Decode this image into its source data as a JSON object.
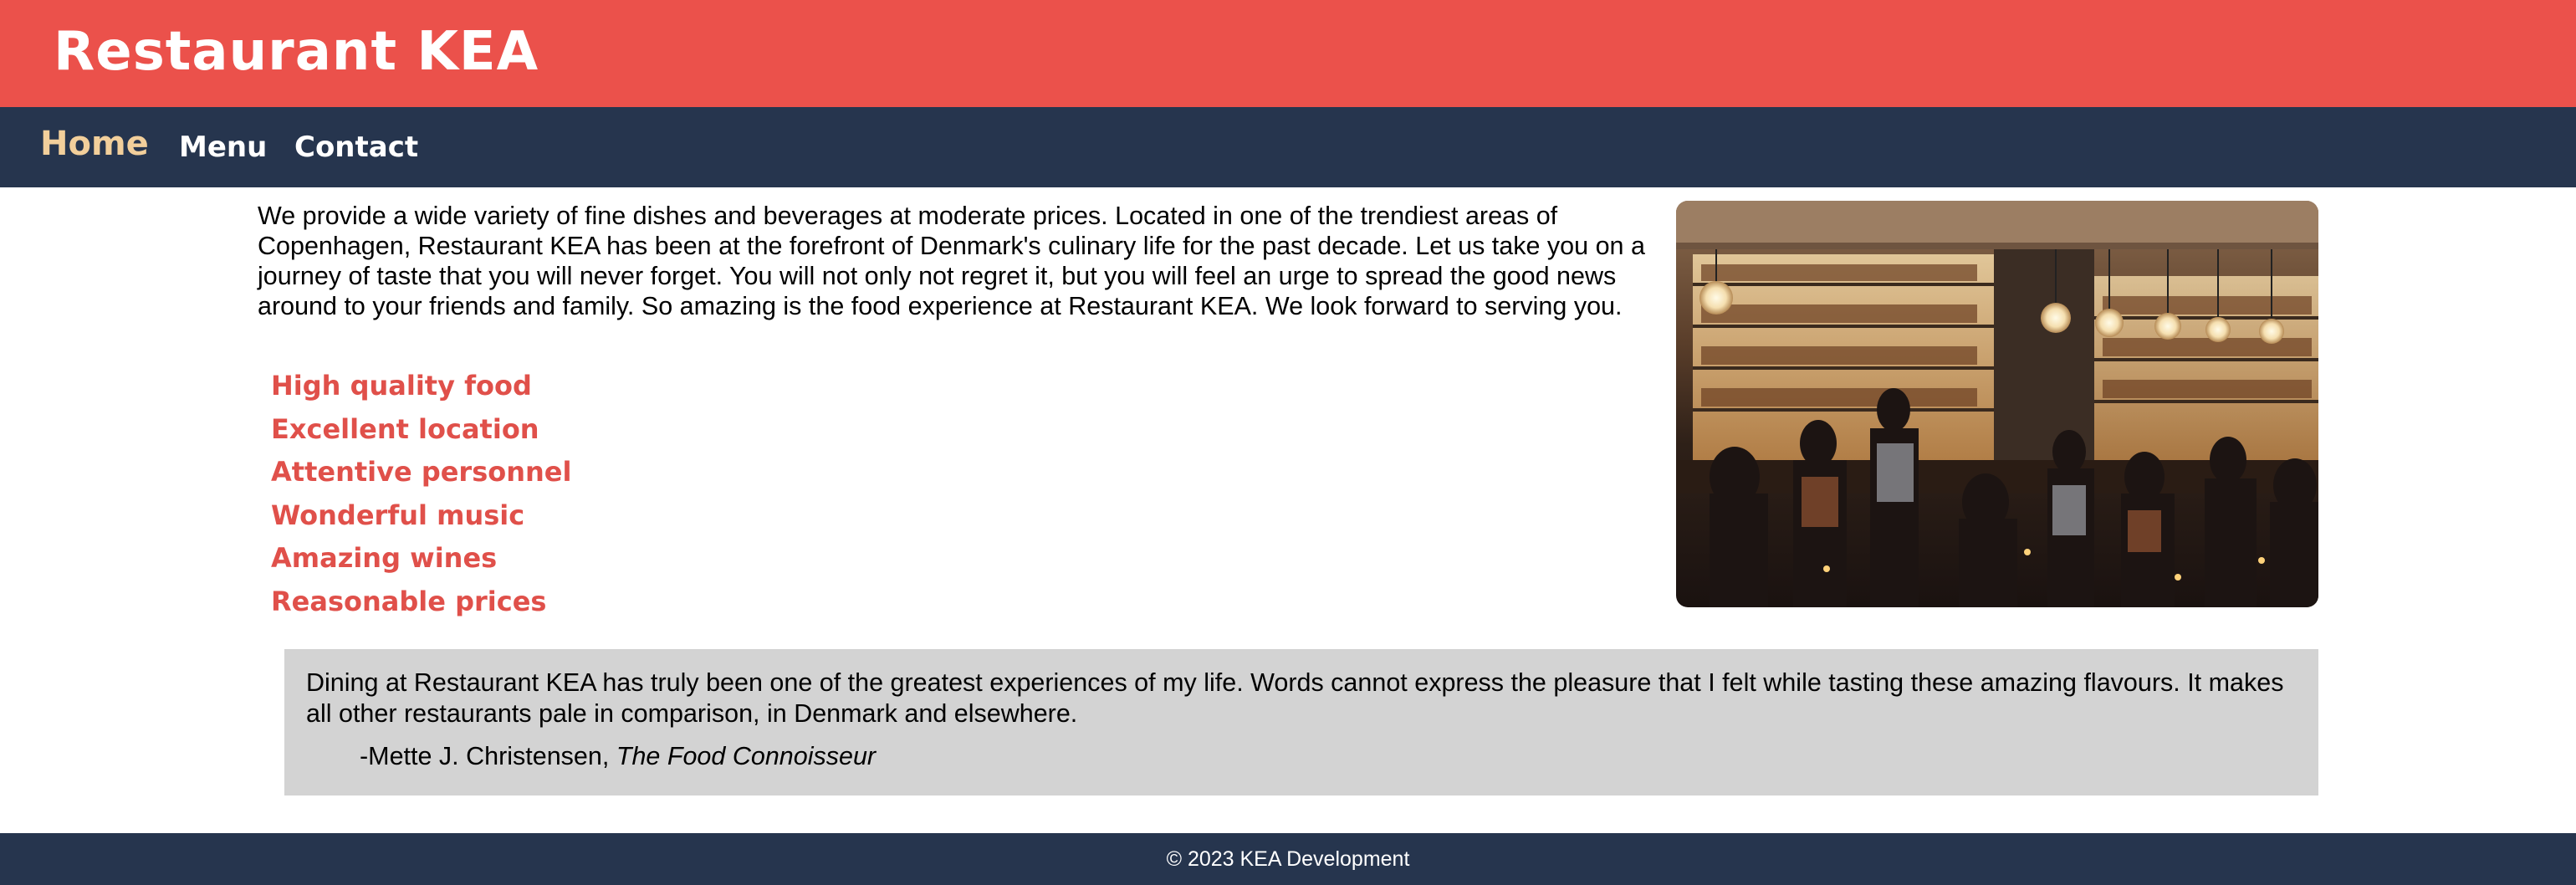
{
  "header": {
    "title": "Restaurant KEA"
  },
  "nav": {
    "items": [
      {
        "label": "Home"
      },
      {
        "label": "Menu"
      },
      {
        "label": "Contact"
      }
    ],
    "active_color": "#f2cf9b"
  },
  "intro": {
    "text": "We provide a wide variety of fine dishes and beverages at moderate prices. Located in one of the trendiest areas of Copenhagen, Restaurant KEA has been at the forefront of Denmark's culinary life for the past decade. Let us take you on a journey of taste that you will never forget. You will not only not regret it, but you will feel an urge to spread the good news around to your friends and family. So amazing is the food experience at Restaurant KEA. We look forward to serving you."
  },
  "features": [
    "High quality food",
    "Excellent location",
    "Attentive personnel",
    "Wonderful music",
    "Amazing wines",
    "Reasonable prices"
  ],
  "testimonial": {
    "text": "Dining at Restaurant KEA has truly been one of the greatest experiences of my life. Words cannot express the pleasure that I felt while tasting these amazing flavours. It makes all other restaurants pale in comparison, in Denmark and elsewhere.",
    "author": "-Mette J. Christensen,",
    "source": "The Food Connoisseur"
  },
  "footer": {
    "text": "© 2023 KEA Development"
  },
  "colors": {
    "header_bg": "#eb514b",
    "nav_bg": "#26354e",
    "feature_text": "#e0504a",
    "quote_bg": "#d3d3d3"
  }
}
